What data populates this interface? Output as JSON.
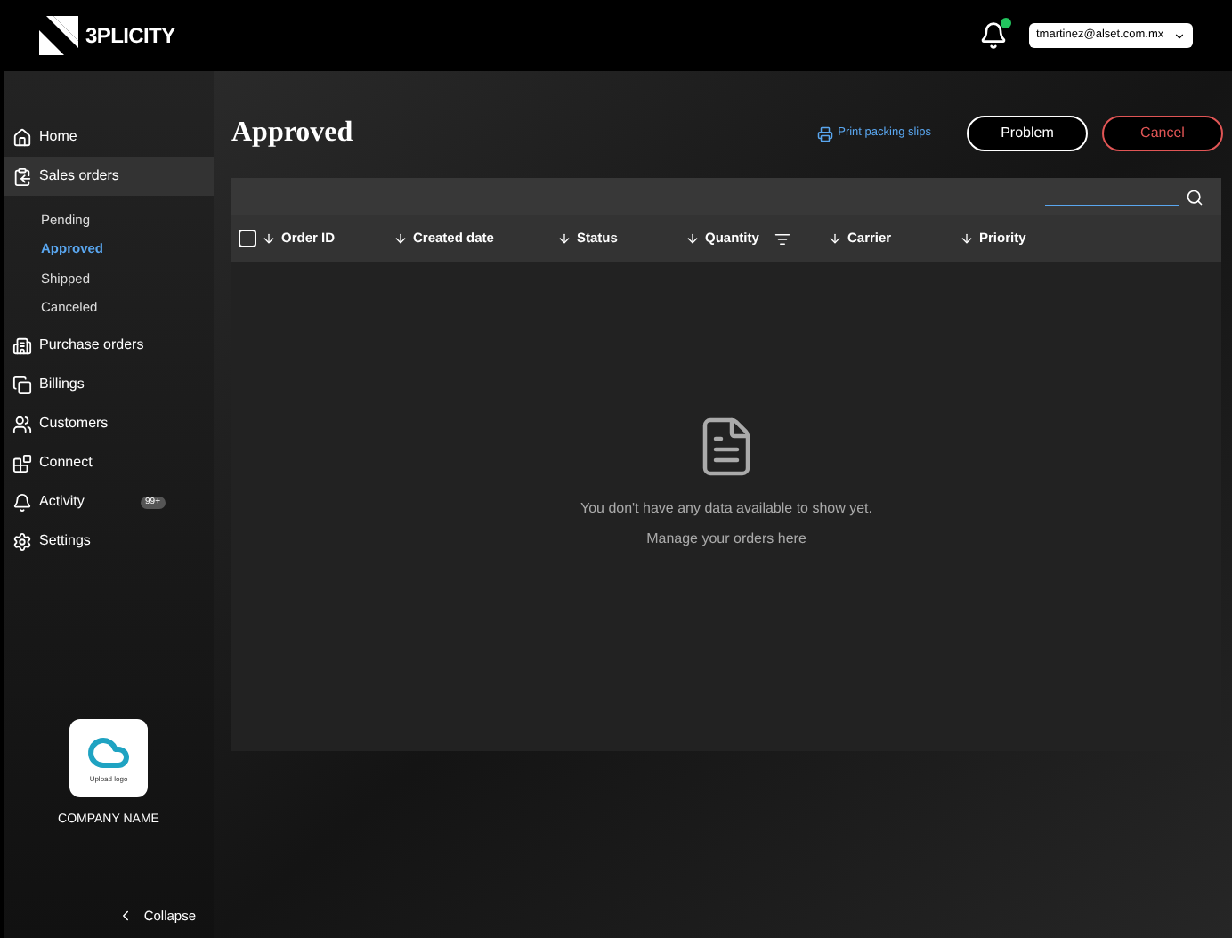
{
  "header": {
    "logo_text": "3PLICITY",
    "notifications_unread": true,
    "account": "tmartinez@alset.com.mx"
  },
  "sidebar": {
    "items": [
      {
        "label": "Home",
        "selected": false
      },
      {
        "label": "Sales orders",
        "selected": true,
        "children": [
          {
            "label": "Pending",
            "selected": false
          },
          {
            "label": "Approved",
            "selected": true
          },
          {
            "label": "Shipped",
            "selected": false
          },
          {
            "label": "Canceled",
            "selected": false
          }
        ]
      },
      {
        "label": "Purchase orders",
        "selected": false
      },
      {
        "label": "Billings",
        "selected": false
      },
      {
        "label": "Customers",
        "selected": false
      },
      {
        "label": "Connect",
        "selected": false
      },
      {
        "label": "Activity",
        "selected": false,
        "badge": "99+"
      },
      {
        "label": "Settings",
        "selected": false
      }
    ],
    "logo_caption": "Upload logo",
    "company": "COMPANY NAME",
    "collapse": "Collapse"
  },
  "page": {
    "title": "Approved",
    "print_link": "Print packing slips",
    "buttons": [
      {
        "label": "Problem",
        "kind": "neutral"
      },
      {
        "label": "Cancel",
        "kind": "danger"
      }
    ]
  },
  "table": {
    "checked": false,
    "columns": [
      {
        "label": "Order ID",
        "filter": false
      },
      {
        "label": "Created date",
        "filter": false
      },
      {
        "label": "Status",
        "filter": false
      },
      {
        "label": "Quantity",
        "filter": true
      },
      {
        "label": "Carrier",
        "filter": false
      },
      {
        "label": "Priority",
        "filter": false
      }
    ],
    "empty": [
      "You don't have any data available to show yet.",
      "Manage your orders here"
    ]
  }
}
